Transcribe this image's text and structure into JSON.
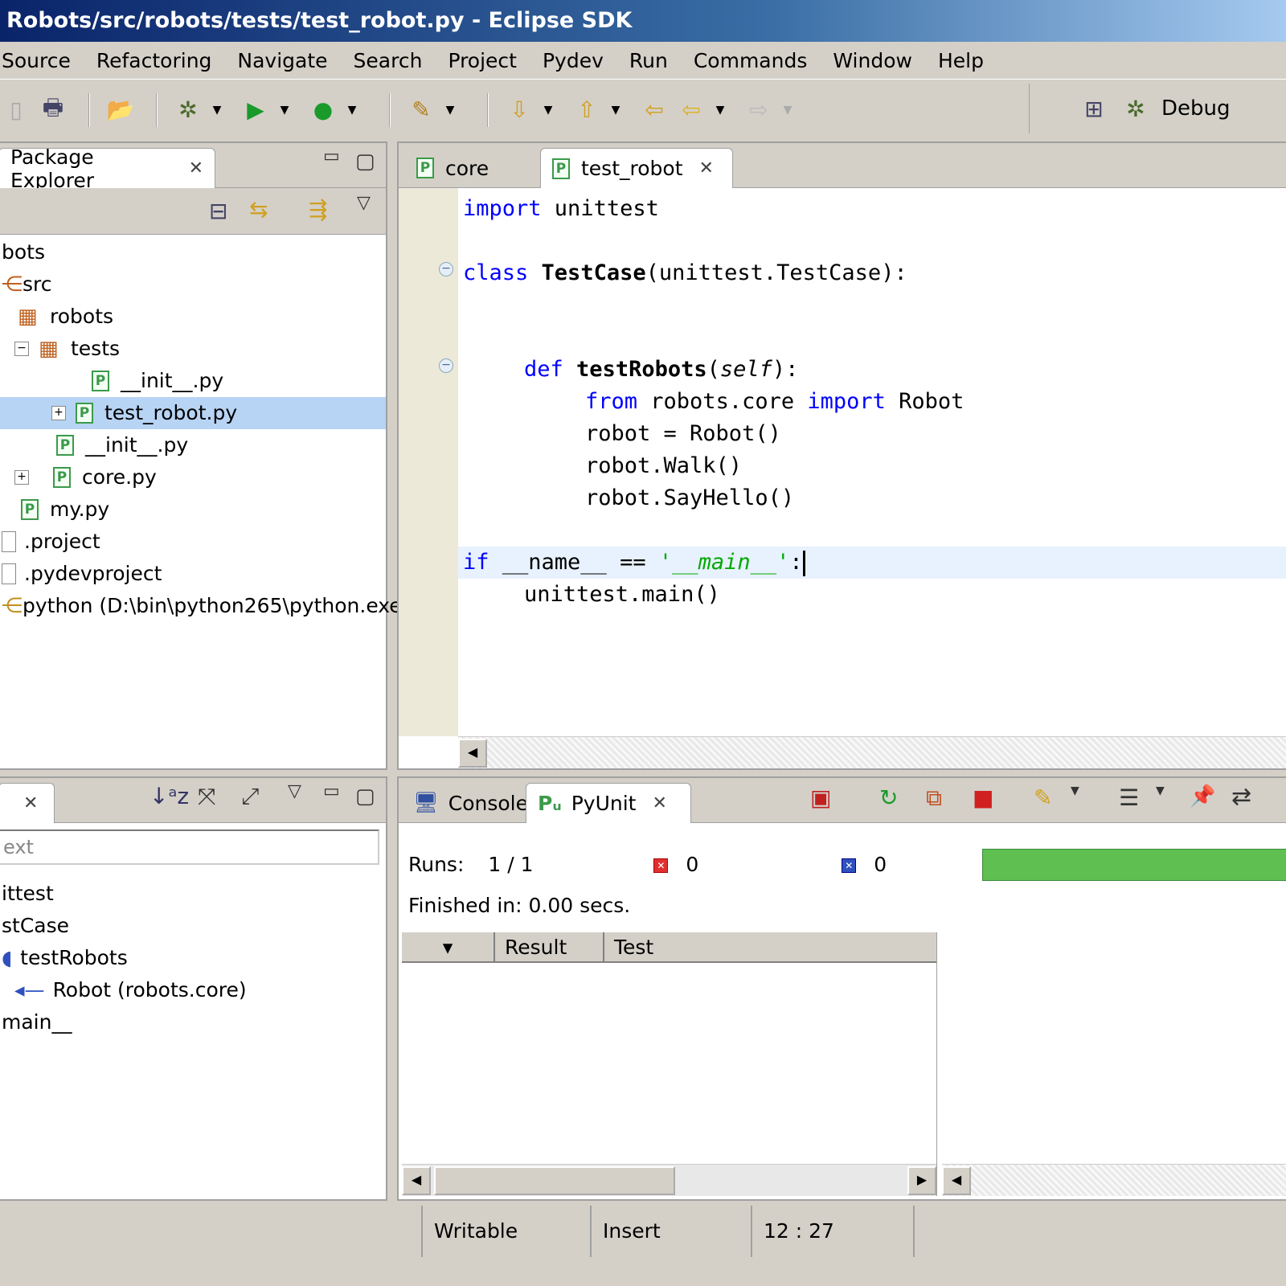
{
  "window": {
    "title": "Robots/src/robots/tests/test_robot.py - Eclipse SDK"
  },
  "menu": [
    "Source",
    "Refactoring",
    "Navigate",
    "Search",
    "Project",
    "Pydev",
    "Run",
    "Commands",
    "Window",
    "Help"
  ],
  "toolbar": {
    "perspective_label": "Debug"
  },
  "package_explorer": {
    "title": "Package Explorer",
    "items": [
      {
        "label": "bots"
      },
      {
        "label": "src"
      },
      {
        "label": "robots"
      },
      {
        "label": "tests"
      },
      {
        "label": "__init__.py"
      },
      {
        "label": "test_robot.py"
      },
      {
        "label": "__init__.py"
      },
      {
        "label": "core.py"
      },
      {
        "label": "my.py"
      },
      {
        "label": ".project"
      },
      {
        "label": ".pydevproject"
      },
      {
        "label": "python  (D:\\bin\\python265\\python.exe)"
      }
    ]
  },
  "editor": {
    "tabs": [
      {
        "label": "core"
      },
      {
        "label": "test_robot"
      }
    ],
    "lines": {
      "l1_kw": "import",
      "l1_rest": " unittest",
      "l2_kw": "class",
      "l2_name": "TestCase",
      "l2_rest": "(unittest.TestCase):",
      "l3_kw": "def",
      "l3_name": "testRobots",
      "l3_open": "(",
      "l3_self": "self",
      "l3_close": "):",
      "l4_kw1": "from",
      "l4_mid": " robots.core ",
      "l4_kw2": "import",
      "l4_rest": " Robot",
      "l5": "robot = Robot()",
      "l6": "robot.Walk()",
      "l7": "robot.SayHello()",
      "l8_kw": "if",
      "l8_mid": " __name__ == ",
      "l8_str": "'__main__'",
      "l8_rest": ":",
      "l9": "unittest.main()"
    }
  },
  "outline": {
    "filter_placeholder": "ext",
    "items": [
      {
        "label": "ittest"
      },
      {
        "label": "stCase"
      },
      {
        "label": "testRobots"
      },
      {
        "label": "Robot (robots.core)"
      },
      {
        "label": "main__"
      }
    ]
  },
  "pyunit": {
    "tabs": [
      {
        "label": "Console"
      },
      {
        "label": "PyUnit"
      }
    ],
    "runs_label": "Runs:",
    "runs_value": "1 / 1",
    "errors": "0",
    "failures": "0",
    "progress": 1.0,
    "finished": "Finished in: 0.00 secs.",
    "columns": [
      "Result",
      "Test"
    ]
  },
  "statusbar": {
    "mode": "Writable",
    "insert": "Insert",
    "position": "12 : 27"
  },
  "colors": {
    "accent": "#0a246a",
    "progress": "#5fbf50",
    "selection": "#b8d4f4"
  }
}
